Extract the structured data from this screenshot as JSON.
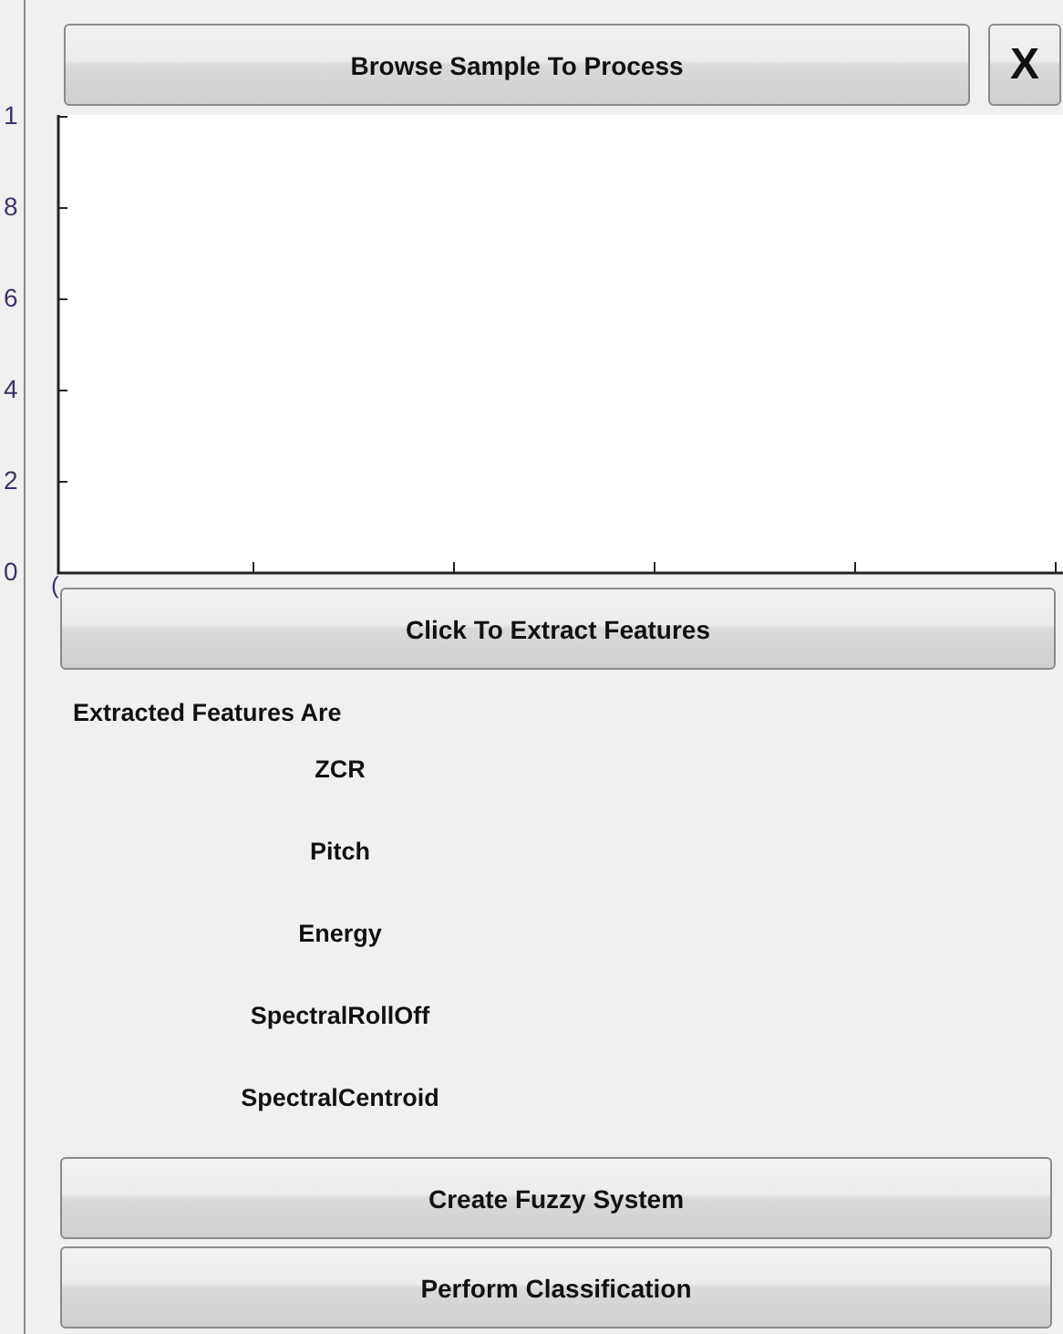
{
  "browse_button": "Browse Sample To Process",
  "close_button": "X",
  "plot": {
    "y_tick_labels": [
      "1",
      "8",
      "6",
      "4",
      "2",
      "0"
    ],
    "x_tick_labels": [
      "("
    ]
  },
  "extract_button": "Click To Extract Features",
  "features_heading": "Extracted Features Are",
  "features": [
    "ZCR",
    "Pitch",
    "Energy",
    "SpectralRollOff",
    "SpectralCentroid"
  ],
  "bottom_buttons": [
    "Create Fuzzy System",
    "Perform Classification"
  ]
}
